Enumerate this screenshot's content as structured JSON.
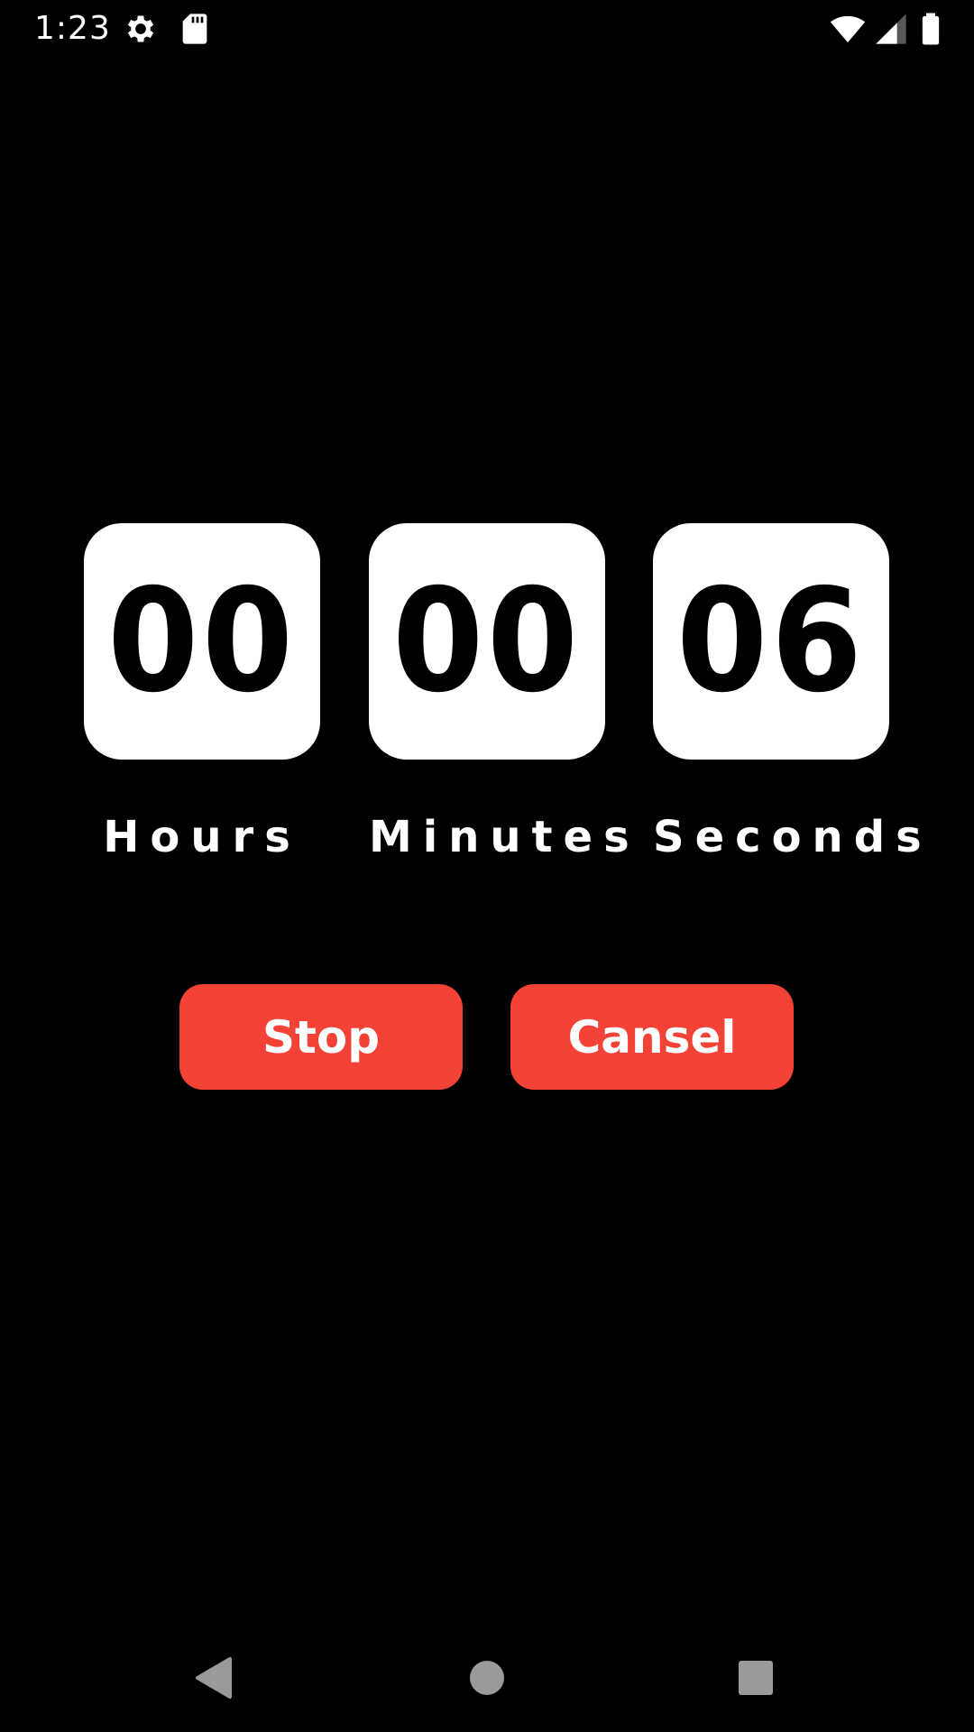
{
  "status_bar": {
    "time": "1:23",
    "icons": [
      "gear-icon",
      "sd-card-icon",
      "wifi-icon",
      "signal-icon",
      "battery-icon"
    ]
  },
  "timer": {
    "hours": "00",
    "minutes": "00",
    "seconds": "06",
    "hours_label": "Hours",
    "minutes_label": "Minutes",
    "seconds_label": "Seconds"
  },
  "buttons": {
    "stop_label": "Stop",
    "cancel_label": "Cansel"
  },
  "nav_bar": {
    "icons": [
      "back-icon",
      "home-icon",
      "recents-icon"
    ]
  },
  "colors": {
    "background": "#000000",
    "accent": "#f44237",
    "box": "#ffffff"
  }
}
